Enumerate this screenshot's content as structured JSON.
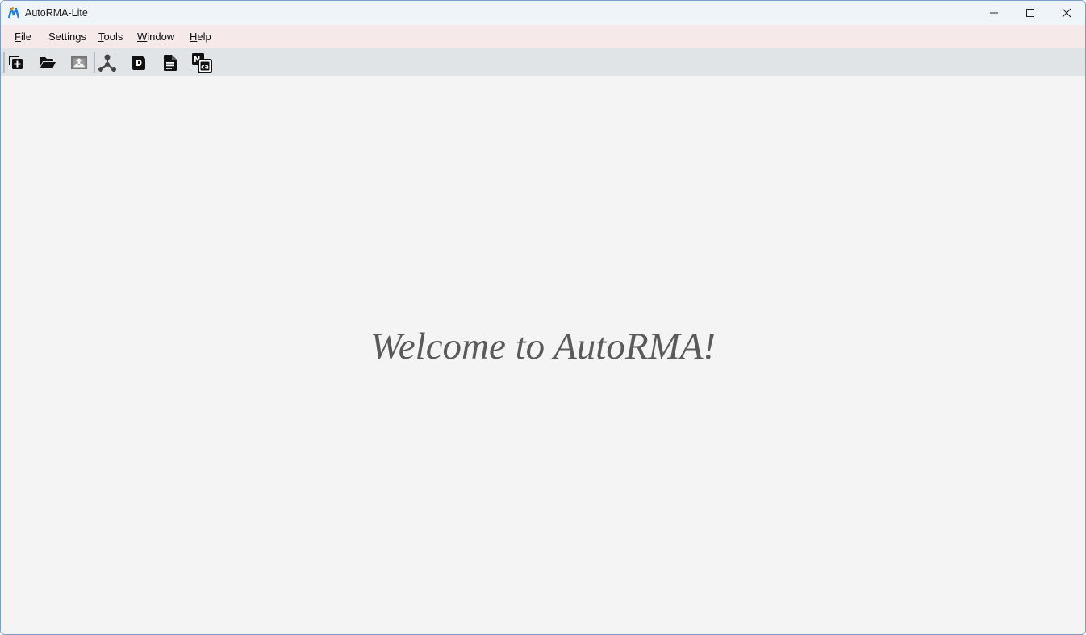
{
  "window": {
    "title": "AutoRMA-Lite",
    "controls": {
      "minimize": "minimize-icon",
      "maximize": "maximize-icon",
      "close": "close-icon"
    }
  },
  "menubar": {
    "items": [
      {
        "label": "File",
        "mnemonic": "F",
        "rest": "ile"
      },
      {
        "label": "Settings",
        "mnemonic": "",
        "rest": "Settings"
      },
      {
        "label": "Tools",
        "mnemonic": "T",
        "rest": "ools"
      },
      {
        "label": "Window",
        "mnemonic": "W",
        "rest": "indow"
      },
      {
        "label": "Help",
        "mnemonic": "H",
        "rest": "elp"
      }
    ]
  },
  "toolbar": {
    "buttons": [
      {
        "icon": "new-project-icon"
      },
      {
        "icon": "open-folder-icon"
      },
      {
        "icon": "import-image-icon"
      },
      {
        "icon": "network-icon"
      },
      {
        "icon": "document-d-icon"
      },
      {
        "icon": "document-icon"
      },
      {
        "icon": "naca-icon",
        "text_top": "N",
        "text_bottom": "ca"
      }
    ]
  },
  "main": {
    "welcome_text": "Welcome to AutoRMA!"
  },
  "colors": {
    "titlebar_bg": "#eff4f9",
    "menubar_bg": "#f5e9ea",
    "toolbar_bg": "#e1e4e6",
    "main_bg": "#f4f4f4",
    "welcome_text": "#5a5a5a",
    "logo_blue": "#1f7fd6",
    "logo_orange": "#f08a24"
  }
}
